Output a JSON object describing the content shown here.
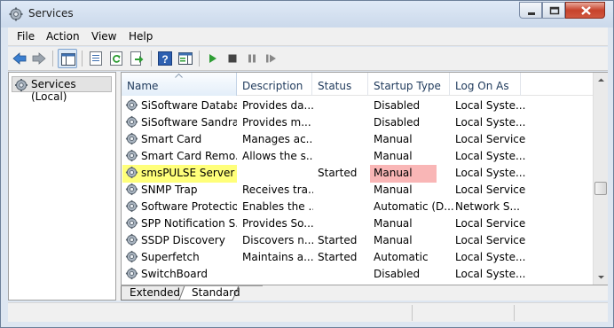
{
  "window": {
    "title": "Services"
  },
  "menu": {
    "items": [
      "File",
      "Action",
      "View",
      "Help"
    ]
  },
  "tree": {
    "item_label": "Services (Local)"
  },
  "columns": [
    "Name",
    "Description",
    "Status",
    "Startup Type",
    "Log On As"
  ],
  "rows": [
    {
      "name": "SiSoftware Databa...",
      "description": "Provides da...",
      "status": "",
      "startup": "Disabled",
      "logon": "Local Syste..."
    },
    {
      "name": "SiSoftware Sandra ...",
      "description": "Provides m...",
      "status": "",
      "startup": "Disabled",
      "logon": "Local Syste..."
    },
    {
      "name": "Smart Card",
      "description": "Manages ac...",
      "status": "",
      "startup": "Manual",
      "logon": "Local Service"
    },
    {
      "name": "Smart Card Remo...",
      "description": "Allows the s...",
      "status": "",
      "startup": "Manual",
      "logon": "Local Syste..."
    },
    {
      "name": "smsPULSE Server",
      "description": "",
      "status": "Started",
      "startup": "Manual",
      "logon": "Local Syste...",
      "highlight": true
    },
    {
      "name": "SNMP Trap",
      "description": "Receives tra...",
      "status": "",
      "startup": "Manual",
      "logon": "Local Service"
    },
    {
      "name": "Software Protection",
      "description": "Enables the ...",
      "status": "",
      "startup": "Automatic (D...",
      "logon": "Network S..."
    },
    {
      "name": "SPP Notification S...",
      "description": "Provides So...",
      "status": "",
      "startup": "Manual",
      "logon": "Local Service"
    },
    {
      "name": "SSDP Discovery",
      "description": "Discovers n...",
      "status": "Started",
      "startup": "Manual",
      "logon": "Local Service"
    },
    {
      "name": "Superfetch",
      "description": "Maintains a...",
      "status": "Started",
      "startup": "Automatic",
      "logon": "Local Syste..."
    },
    {
      "name": "SwitchBoard",
      "description": "",
      "status": "",
      "startup": "Disabled",
      "logon": "Local Syste..."
    }
  ],
  "tabs": {
    "extended": "Extended",
    "standard": "Standard"
  },
  "colors": {
    "highlight_name": "#ffff7a",
    "highlight_startup": "#f9b6b6",
    "header_text": "#1e395b",
    "play_green": "#2e9d34"
  },
  "icons": [
    "services-gear-icon",
    "back-arrow-icon",
    "forward-arrow-icon",
    "console-tree-icon",
    "properties-icon",
    "refresh-icon",
    "export-icon",
    "help-icon",
    "details-pane-icon",
    "play-icon",
    "stop-icon",
    "pause-icon",
    "restart-icon"
  ]
}
